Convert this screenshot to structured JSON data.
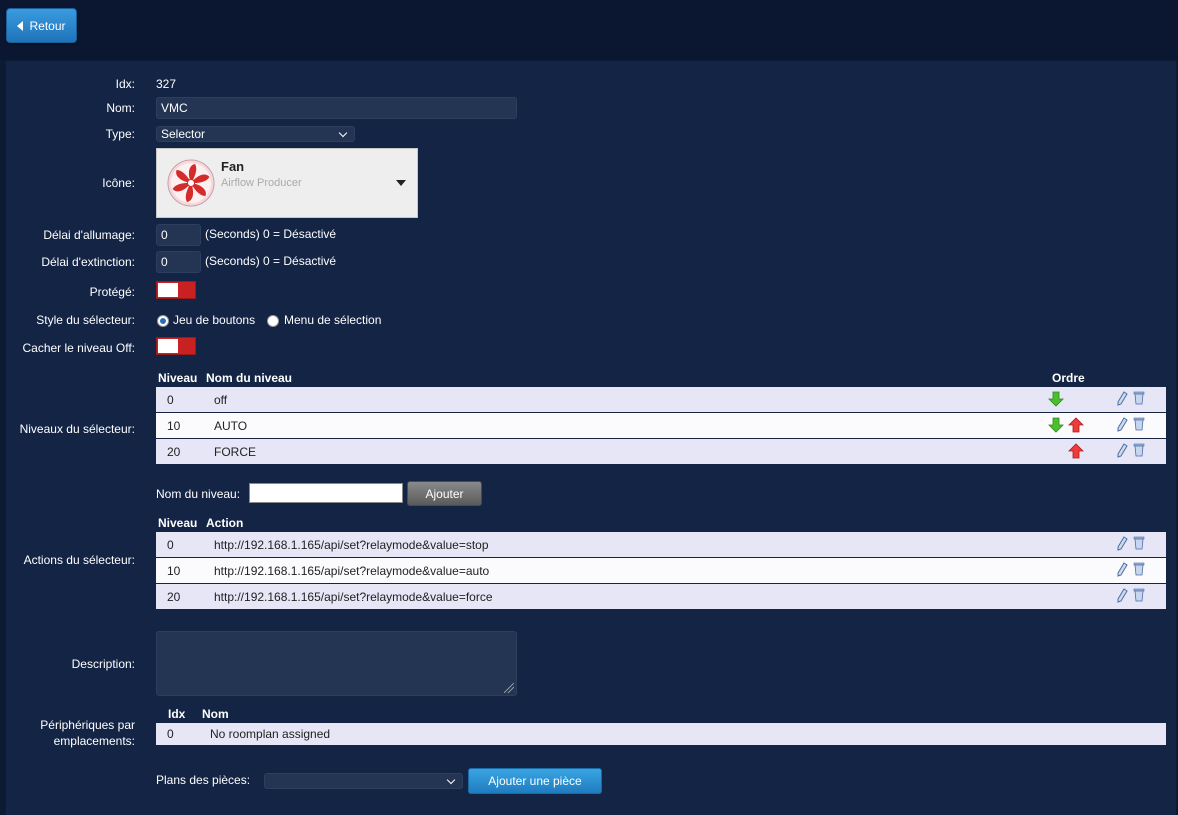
{
  "header": {
    "back_label": "Retour"
  },
  "form": {
    "idx_label": "Idx:",
    "idx_value": "327",
    "name_label": "Nom:",
    "name_value": "VMC",
    "type_label": "Type:",
    "type_value": "Selector",
    "icon_label": "Icône:",
    "icon_name": "Fan",
    "icon_description": "Airflow Producer",
    "on_delay_label": "Délai d'allumage:",
    "on_delay_value": "0",
    "on_delay_hint": "(Seconds) 0 = Désactivé",
    "off_delay_label": "Délai d'extinction:",
    "off_delay_value": "0",
    "off_delay_hint": "(Seconds) 0 = Désactivé",
    "protected_label": "Protégé:",
    "style_label": "Style du sélecteur:",
    "style_option_buttons": "Jeu de boutons",
    "style_option_menu": "Menu de sélection",
    "hide_off_label": "Cacher le niveau Off:",
    "description_label": "Description:"
  },
  "levels": {
    "section_label": "Niveaux du sélecteur:",
    "col_level": "Niveau",
    "col_name": "Nom du niveau",
    "col_order": "Ordre",
    "rows": [
      {
        "level": "0",
        "name": "off"
      },
      {
        "level": "10",
        "name": "AUTO"
      },
      {
        "level": "20",
        "name": "FORCE"
      }
    ],
    "new_level_label": "Nom du niveau:",
    "add_button": "Ajouter"
  },
  "actions": {
    "section_label": "Actions du sélecteur:",
    "col_level": "Niveau",
    "col_action": "Action",
    "rows": [
      {
        "level": "0",
        "action": "http://192.168.1.165/api/set?relaymode&value=stop"
      },
      {
        "level": "10",
        "action": "http://192.168.1.165/api/set?relaymode&value=auto"
      },
      {
        "level": "20",
        "action": "http://192.168.1.165/api/set?relaymode&value=force"
      }
    ]
  },
  "roomplans": {
    "section_label": "Périphériques par emplacements:",
    "col_idx": "Idx",
    "col_name": "Nom",
    "rows": [
      {
        "idx": "0",
        "name": "No roomplan assigned"
      }
    ],
    "plans_label": "Plans des pièces:",
    "add_button": "Ajouter une pièce"
  },
  "colors": {
    "background": "#0d1a33",
    "panel": "#132445",
    "toggle_off": "#c92121",
    "button_blue": "#2a87cf"
  }
}
